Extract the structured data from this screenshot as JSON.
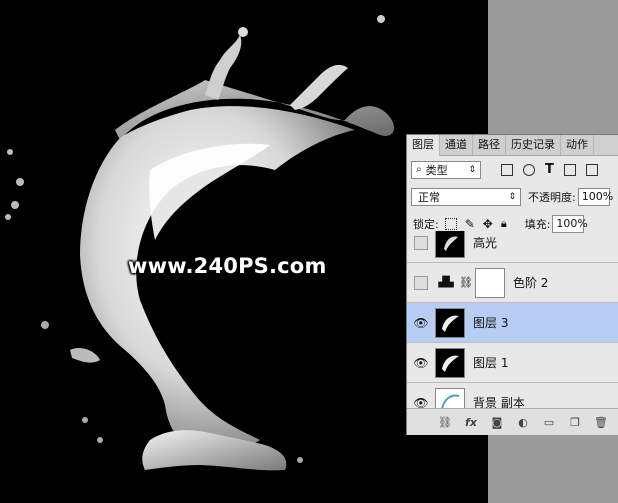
{
  "watermark": "www.240PS.com",
  "tabs": [
    {
      "label": "图层",
      "active": true
    },
    {
      "label": "通道",
      "active": false
    },
    {
      "label": "路径",
      "active": false
    },
    {
      "label": "历史记录",
      "active": false
    },
    {
      "label": "动作",
      "active": false
    }
  ],
  "filter": {
    "label": "类型",
    "icon": "search-icon"
  },
  "blend": {
    "mode": "正常",
    "opacity_label": "不透明度:",
    "opacity": "100%"
  },
  "lock": {
    "label": "锁定:",
    "fill_label": "填充:",
    "fill": "100%"
  },
  "layers": [
    {
      "name": "高光",
      "visible": false
    },
    {
      "name": "色阶 2",
      "visible": false
    },
    {
      "name": "图层 3",
      "visible": true,
      "selected": true
    },
    {
      "name": "图层 1",
      "visible": true
    },
    {
      "name": "背景 副本",
      "visible": true
    }
  ],
  "footer": {
    "fx": "fx"
  },
  "colors": {
    "selected": "#b8cdf4",
    "panel": "#e8e8e8",
    "canvas": "#000000",
    "gray": "#9a9a9a"
  }
}
